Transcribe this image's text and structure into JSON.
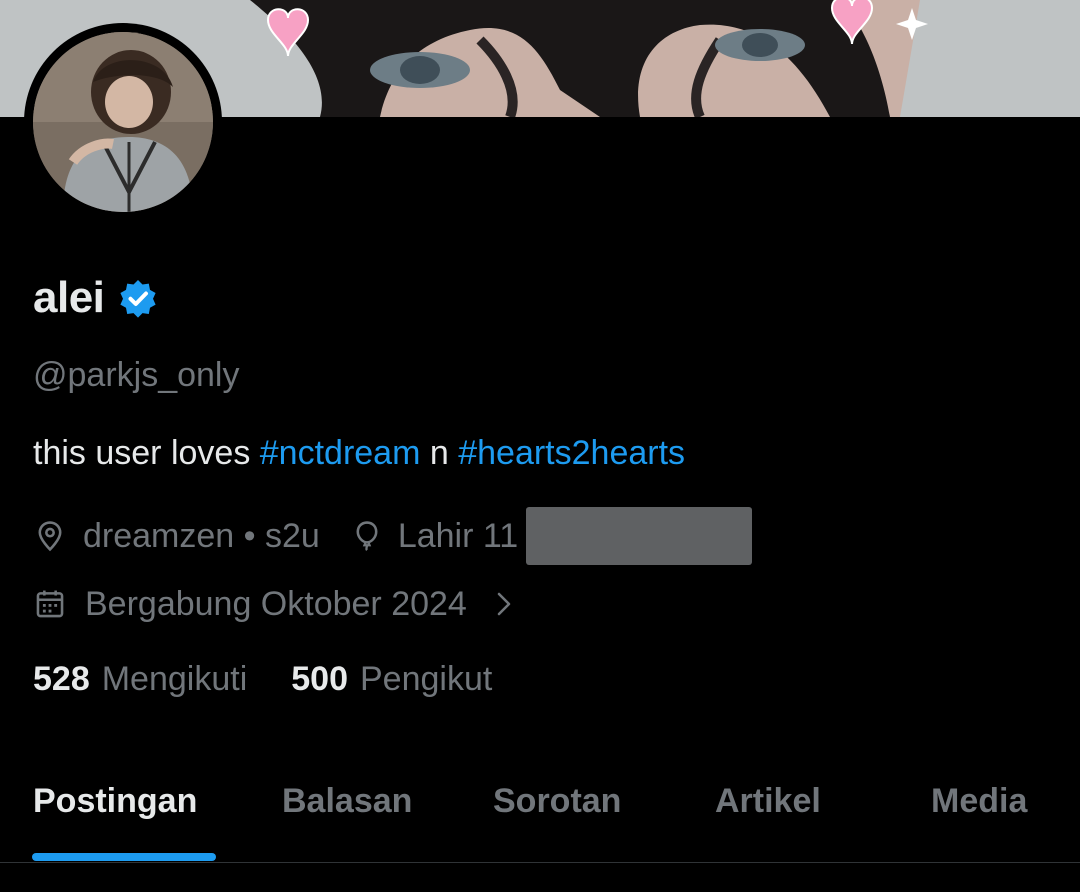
{
  "profile": {
    "display_name": "alei",
    "handle": "@parkjs_only",
    "bio": {
      "text1": "this user loves ",
      "hashtag1": "#nctdream",
      "text2": " n ",
      "hashtag2": "#hearts2hearts"
    },
    "location": "dreamzen • s2u",
    "birthday": "Lahir 11",
    "joined": "Bergabung Oktober 2024"
  },
  "stats": {
    "following_count": "528",
    "following_label": "Mengikuti",
    "followers_count": "500",
    "followers_label": "Pengikut"
  },
  "tabs": [
    "Postingan",
    "Balasan",
    "Sorotan",
    "Artikel",
    "Media"
  ],
  "active_tab": "Postingan",
  "icons": {
    "verified": "verified-badge-icon",
    "location": "location-pin-icon",
    "birthday": "balloon-icon",
    "joined": "calendar-icon",
    "expand": "chevron-right-icon"
  },
  "colors": {
    "background": "#000000",
    "accent": "#1d9bf0",
    "primary_text": "#e7e9ea",
    "secondary_text": "#71767b",
    "heart": "#f7a1c4"
  }
}
